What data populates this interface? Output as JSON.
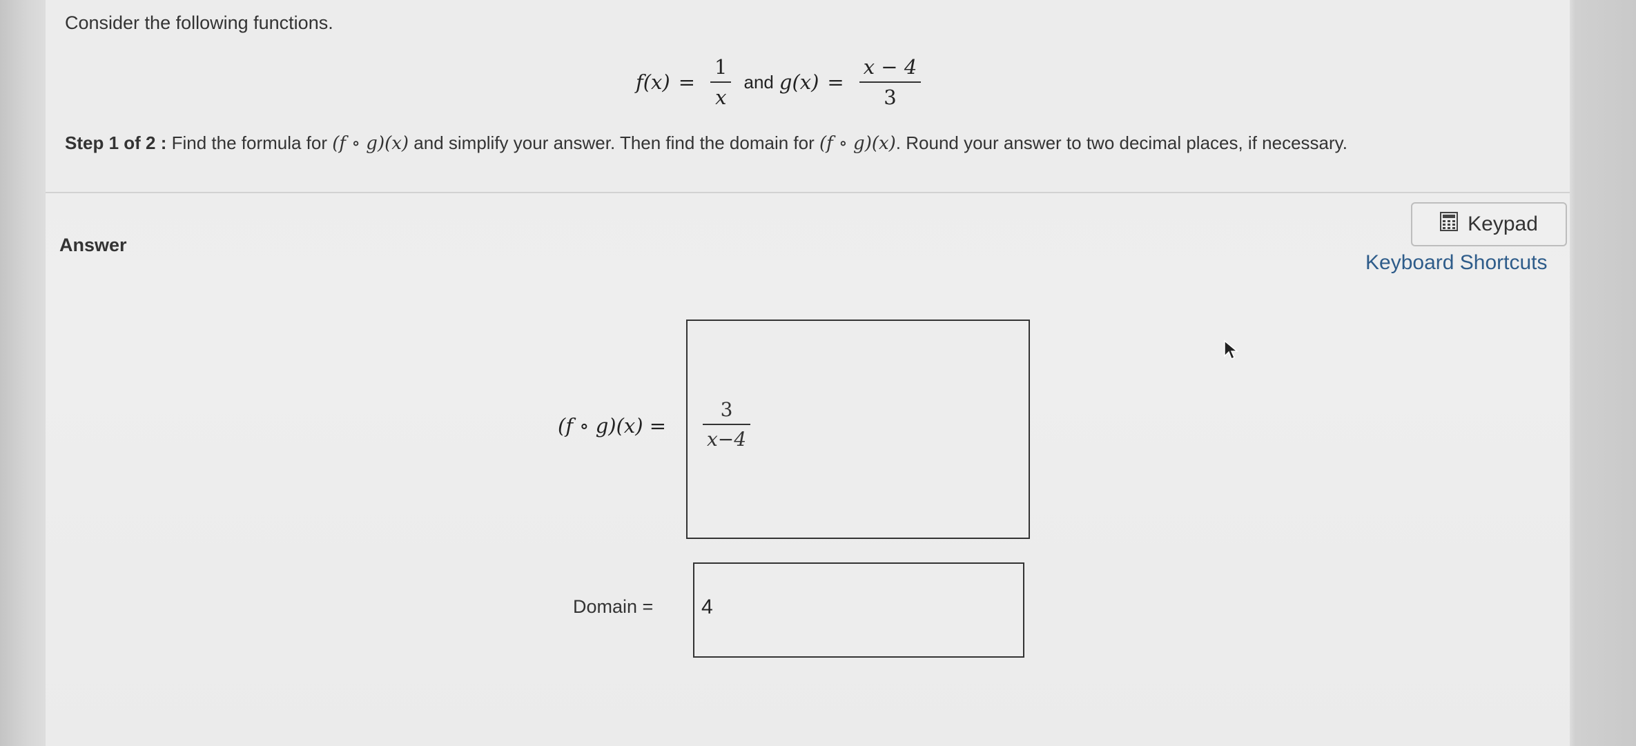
{
  "question": {
    "intro": "Consider the following functions.",
    "f": {
      "lhs": "f(x)",
      "eq": "=",
      "num": "1",
      "den": "x"
    },
    "and": "and",
    "g": {
      "lhs": "g(x)",
      "eq": "=",
      "num": "x − 4",
      "den": "3"
    },
    "step_label": "Step 1 of 2 :",
    "step_text_1": "Find the formula for",
    "step_expr": "(f ∘ g)(x)",
    "step_text_2": "and simplify your answer. Then find the domain for",
    "step_text_3": ". Round your answer to two decimal places, if necessary."
  },
  "answer": {
    "label": "Answer",
    "keypad_label": "Keypad",
    "keyboard_shortcuts": "Keyboard Shortcuts",
    "composition_label": "(f ∘ g)(x) =",
    "composition_num": "3",
    "composition_den": "x−4",
    "domain_label": "Domain =",
    "domain_value": "4"
  },
  "icons": [
    "calculator-icon",
    "mouse-pointer-icon"
  ]
}
